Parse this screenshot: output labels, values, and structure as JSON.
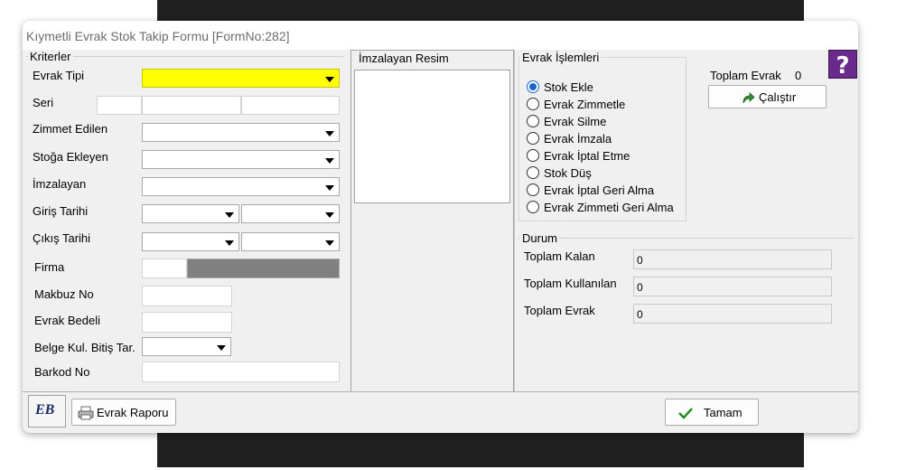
{
  "window": {
    "title": "Kıymetli Evrak Stok Takip Formu [FormNo:282]"
  },
  "kriterler": {
    "group_title": "Kriterler",
    "evrak_tipi": "Evrak Tipi",
    "seri": "Seri",
    "zimmet_edilen": "Zimmet Edilen",
    "stoga_ekleyen": "Stoğa Ekleyen",
    "imzalayan": "İmzalayan",
    "giris_tarihi": "Giriş Tarihi",
    "cikis_tarihi": "Çıkış Tarihi",
    "firma": "Firma",
    "makbuz_no": "Makbuz No",
    "evrak_bedeli": "Evrak Bedeli",
    "belge_kul_bitis": "Belge Kul. Bitiş Tar.",
    "barkod_no": "Barkod No"
  },
  "imzalayan_resim": {
    "title": "İmzalayan Resim"
  },
  "evrak_islemleri": {
    "title": "Evrak İşlemleri",
    "options": [
      "Stok Ekle",
      "Evrak Zimmetle",
      "Evrak Silme",
      "Evrak İmzala",
      "Evrak İptal Etme",
      "Stok Düş",
      "Evrak İptal Geri Alma",
      "Evrak Zimmeti Geri Alma"
    ],
    "selected": "Stok Ekle",
    "toplam_evrak_label": "Toplam Evrak",
    "toplam_evrak_value": "0",
    "calistir": "Çalıştır"
  },
  "durum": {
    "title": "Durum",
    "toplam_kalan_label": "Toplam Kalan",
    "toplam_kalan_value": "0",
    "toplam_kullanilan_label": "Toplam Kullanılan",
    "toplam_kullanilan_value": "0",
    "toplam_evrak_label": "Toplam Evrak",
    "toplam_evrak_value": "0"
  },
  "footer": {
    "logo_text": "EB",
    "evrak_raporu": "Evrak Raporu",
    "tamam": "Tamam"
  },
  "icons": {
    "help": "help-icon",
    "calistir": "arrow-redo-icon",
    "rapor": "printer-icon",
    "tamam": "checkmark-icon"
  },
  "colors": {
    "evrak_tipi_field": "#ffff00",
    "help": "#6a2a8c",
    "radio_selected": "#1a64c8",
    "tamam_check": "#1a8a1a",
    "firma_field": "#808080"
  }
}
